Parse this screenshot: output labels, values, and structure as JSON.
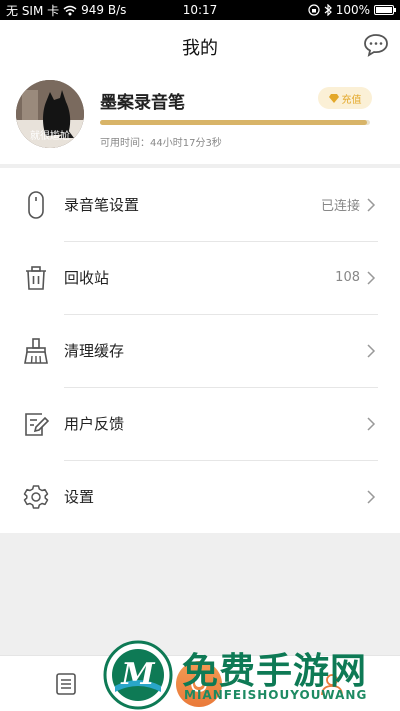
{
  "status_bar": {
    "carrier": "无 SIM 卡",
    "net_speed": "949 B/s",
    "time": "10:17",
    "battery": "100%"
  },
  "header": {
    "title": "我的"
  },
  "profile": {
    "avatar_caption": "就很尴尬",
    "device_name": "墨案录音笔",
    "recharge_label": "充值",
    "usable_time": "可用时间：44小时17分3秒",
    "usage_fraction": 0.99
  },
  "menu": [
    {
      "label": "录音笔设置",
      "value": "已连接",
      "icon": "pen-device-icon"
    },
    {
      "label": "回收站",
      "value": "108",
      "icon": "trash-icon"
    },
    {
      "label": "清理缓存",
      "value": "",
      "icon": "broom-icon"
    },
    {
      "label": "用户反馈",
      "value": "",
      "icon": "feedback-icon"
    },
    {
      "label": "设置",
      "value": "",
      "icon": "gear-icon"
    }
  ],
  "tabbar": {
    "files_icon": "list-icon",
    "record_icon": "microphone-icon",
    "me_icon": "user-icon"
  },
  "watermark": {
    "title": "免费手游网",
    "subtitle": "MIANFEISHOUYOUWANG",
    "logo_letter": "M"
  },
  "colors": {
    "accent_gold": "#d8b468",
    "recharge_text": "#e3a82a",
    "record_orange": "#ea7a3a",
    "watermark_green": "#0e7a55"
  }
}
